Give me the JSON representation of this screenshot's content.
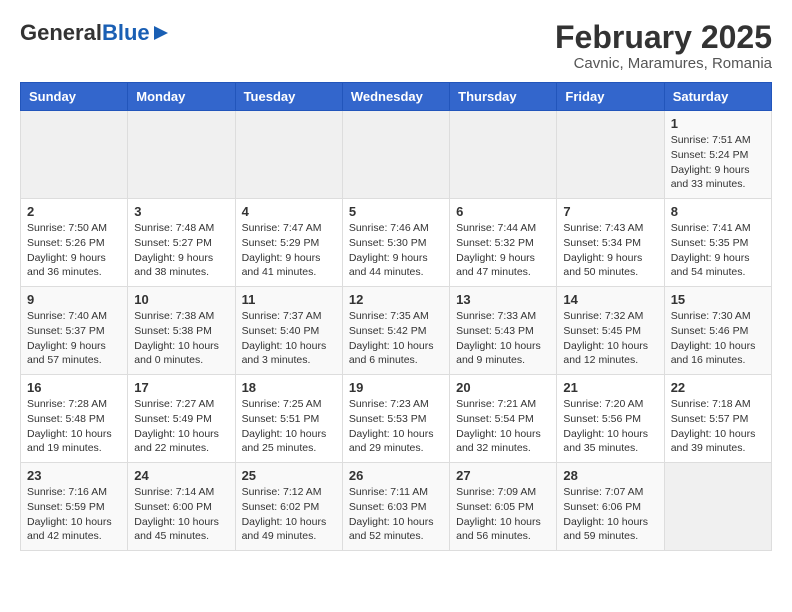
{
  "header": {
    "logo_general": "General",
    "logo_blue": "Blue",
    "title": "February 2025",
    "subtitle": "Cavnic, Maramures, Romania"
  },
  "weekdays": [
    "Sunday",
    "Monday",
    "Tuesday",
    "Wednesday",
    "Thursday",
    "Friday",
    "Saturday"
  ],
  "weeks": [
    [
      {
        "day": "",
        "info": ""
      },
      {
        "day": "",
        "info": ""
      },
      {
        "day": "",
        "info": ""
      },
      {
        "day": "",
        "info": ""
      },
      {
        "day": "",
        "info": ""
      },
      {
        "day": "",
        "info": ""
      },
      {
        "day": "1",
        "info": "Sunrise: 7:51 AM\nSunset: 5:24 PM\nDaylight: 9 hours and 33 minutes."
      }
    ],
    [
      {
        "day": "2",
        "info": "Sunrise: 7:50 AM\nSunset: 5:26 PM\nDaylight: 9 hours and 36 minutes."
      },
      {
        "day": "3",
        "info": "Sunrise: 7:48 AM\nSunset: 5:27 PM\nDaylight: 9 hours and 38 minutes."
      },
      {
        "day": "4",
        "info": "Sunrise: 7:47 AM\nSunset: 5:29 PM\nDaylight: 9 hours and 41 minutes."
      },
      {
        "day": "5",
        "info": "Sunrise: 7:46 AM\nSunset: 5:30 PM\nDaylight: 9 hours and 44 minutes."
      },
      {
        "day": "6",
        "info": "Sunrise: 7:44 AM\nSunset: 5:32 PM\nDaylight: 9 hours and 47 minutes."
      },
      {
        "day": "7",
        "info": "Sunrise: 7:43 AM\nSunset: 5:34 PM\nDaylight: 9 hours and 50 minutes."
      },
      {
        "day": "8",
        "info": "Sunrise: 7:41 AM\nSunset: 5:35 PM\nDaylight: 9 hours and 54 minutes."
      }
    ],
    [
      {
        "day": "9",
        "info": "Sunrise: 7:40 AM\nSunset: 5:37 PM\nDaylight: 9 hours and 57 minutes."
      },
      {
        "day": "10",
        "info": "Sunrise: 7:38 AM\nSunset: 5:38 PM\nDaylight: 10 hours and 0 minutes."
      },
      {
        "day": "11",
        "info": "Sunrise: 7:37 AM\nSunset: 5:40 PM\nDaylight: 10 hours and 3 minutes."
      },
      {
        "day": "12",
        "info": "Sunrise: 7:35 AM\nSunset: 5:42 PM\nDaylight: 10 hours and 6 minutes."
      },
      {
        "day": "13",
        "info": "Sunrise: 7:33 AM\nSunset: 5:43 PM\nDaylight: 10 hours and 9 minutes."
      },
      {
        "day": "14",
        "info": "Sunrise: 7:32 AM\nSunset: 5:45 PM\nDaylight: 10 hours and 12 minutes."
      },
      {
        "day": "15",
        "info": "Sunrise: 7:30 AM\nSunset: 5:46 PM\nDaylight: 10 hours and 16 minutes."
      }
    ],
    [
      {
        "day": "16",
        "info": "Sunrise: 7:28 AM\nSunset: 5:48 PM\nDaylight: 10 hours and 19 minutes."
      },
      {
        "day": "17",
        "info": "Sunrise: 7:27 AM\nSunset: 5:49 PM\nDaylight: 10 hours and 22 minutes."
      },
      {
        "day": "18",
        "info": "Sunrise: 7:25 AM\nSunset: 5:51 PM\nDaylight: 10 hours and 25 minutes."
      },
      {
        "day": "19",
        "info": "Sunrise: 7:23 AM\nSunset: 5:53 PM\nDaylight: 10 hours and 29 minutes."
      },
      {
        "day": "20",
        "info": "Sunrise: 7:21 AM\nSunset: 5:54 PM\nDaylight: 10 hours and 32 minutes."
      },
      {
        "day": "21",
        "info": "Sunrise: 7:20 AM\nSunset: 5:56 PM\nDaylight: 10 hours and 35 minutes."
      },
      {
        "day": "22",
        "info": "Sunrise: 7:18 AM\nSunset: 5:57 PM\nDaylight: 10 hours and 39 minutes."
      }
    ],
    [
      {
        "day": "23",
        "info": "Sunrise: 7:16 AM\nSunset: 5:59 PM\nDaylight: 10 hours and 42 minutes."
      },
      {
        "day": "24",
        "info": "Sunrise: 7:14 AM\nSunset: 6:00 PM\nDaylight: 10 hours and 45 minutes."
      },
      {
        "day": "25",
        "info": "Sunrise: 7:12 AM\nSunset: 6:02 PM\nDaylight: 10 hours and 49 minutes."
      },
      {
        "day": "26",
        "info": "Sunrise: 7:11 AM\nSunset: 6:03 PM\nDaylight: 10 hours and 52 minutes."
      },
      {
        "day": "27",
        "info": "Sunrise: 7:09 AM\nSunset: 6:05 PM\nDaylight: 10 hours and 56 minutes."
      },
      {
        "day": "28",
        "info": "Sunrise: 7:07 AM\nSunset: 6:06 PM\nDaylight: 10 hours and 59 minutes."
      },
      {
        "day": "",
        "info": ""
      }
    ]
  ]
}
